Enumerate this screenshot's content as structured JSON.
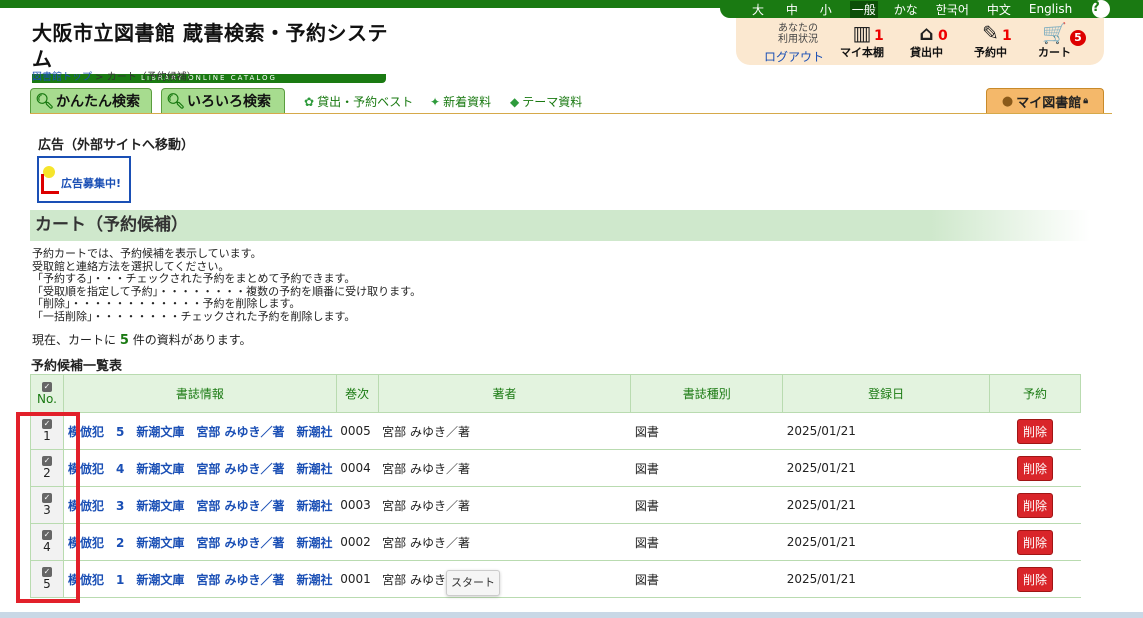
{
  "header": {
    "logo_title": "大阪市立図書館 蔵書検索・予約システム",
    "logo_subtitle": "LIBRARY ONLINE CATALOG",
    "font_sizes": [
      "大",
      "中",
      "小"
    ],
    "languages": [
      "一般",
      "かな",
      "한국어",
      "中文",
      "English"
    ],
    "help_label": "?",
    "user_info_line1": "あなたの",
    "user_info_line2": "利用状況",
    "logout_label": "ログアウト",
    "status": {
      "bookshelf": {
        "label": "マイ本棚",
        "count": "1"
      },
      "lending": {
        "label": "貸出中",
        "count": "0"
      },
      "reserved": {
        "label": "予約中",
        "count": "1"
      },
      "cart": {
        "label": "カート",
        "count": "5"
      }
    }
  },
  "breadcrumb": {
    "home": "図書館トップ",
    "separator": " > ",
    "current": "カート（予約候補）"
  },
  "nav": {
    "simple_search": "かんたん検索",
    "advanced_search": "いろいろ検索",
    "best": "貸出・予約ベスト",
    "new": "新着資料",
    "theme": "テーマ資料",
    "my_library": "マイ図書館"
  },
  "ad": {
    "label": "広告（外部サイトへ移動）",
    "banner_text": "広告募集中!"
  },
  "section_title": "カート（予約候補）",
  "description": [
    "予約カートでは、予約候補を表示しています。",
    "受取館と連絡方法を選択してください。",
    "「予約する」・・・チェックされた予約をまとめて予約できます。",
    "「受取順を指定して予約」・・・・・・・・複数の予約を順番に受け取ります。",
    "「削除」・・・・・・・・・・・・予約を削除します。",
    "「一括削除」・・・・・・・・チェックされた予約を削除します。"
  ],
  "count_text": {
    "prefix": "現在、カートに ",
    "number": "5",
    "suffix": " 件の資料があります。"
  },
  "list_label": "予約候補一覧表",
  "table": {
    "headers": {
      "no": "No.",
      "info": "書誌情報",
      "volume": "巻次",
      "author": "著者",
      "type": "書誌種別",
      "date": "登録日",
      "reserve": "予約"
    },
    "rows": [
      {
        "no": "1",
        "info": "模倣犯　5　新潮文庫　宮部 みゆき／著　新潮社",
        "volume": "0005",
        "author": "宮部 みゆき／著",
        "type": "図書",
        "date": "2025/01/21",
        "action": "削除"
      },
      {
        "no": "2",
        "info": "模倣犯　4　新潮文庫　宮部 みゆき／著　新潮社",
        "volume": "0004",
        "author": "宮部 みゆき／著",
        "type": "図書",
        "date": "2025/01/21",
        "action": "削除"
      },
      {
        "no": "3",
        "info": "模倣犯　3　新潮文庫　宮部 みゆき／著　新潮社",
        "volume": "0003",
        "author": "宮部 みゆき／著",
        "type": "図書",
        "date": "2025/01/21",
        "action": "削除"
      },
      {
        "no": "4",
        "info": "模倣犯　2　新潮文庫　宮部 みゆき／著　新潮社",
        "volume": "0002",
        "author": "宮部 みゆき／著",
        "type": "図書",
        "date": "2025/01/21",
        "action": "削除"
      },
      {
        "no": "5",
        "info": "模倣犯　1　新潮文庫　宮部 みゆき／著　新潮社",
        "volume": "0001",
        "author": "宮部 みゆき／著",
        "type": "図書",
        "date": "2025/01/21",
        "action": "削除"
      }
    ]
  },
  "tooltip": "スタート",
  "colors": {
    "brand": "#1a7a12",
    "highlight": "#e2202a",
    "delete": "#d9252a"
  }
}
